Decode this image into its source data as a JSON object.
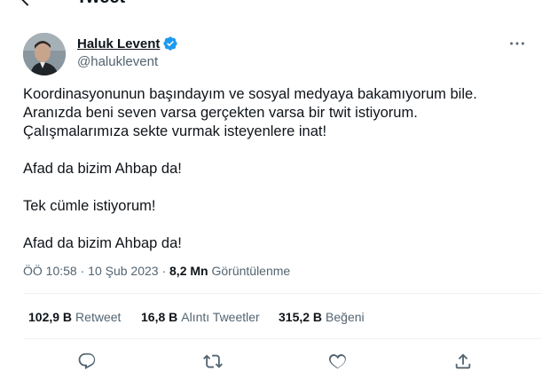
{
  "header": {
    "title": "Tweet"
  },
  "author": {
    "name": "Haluk Levent",
    "handle": "@haluklevent"
  },
  "tweet": {
    "lines": [
      "Koordinasyonunun başındayım ve sosyal medyaya bakamıyorum bile.",
      "Aranızda beni seven varsa gerçekten varsa bir twit istiyorum.",
      "Çalışmalarımıza sekte vurmak isteyenlere inat!",
      "Afad da bizim Ahbap da!",
      "Tek cümle istiyorum!",
      "Afad da bizim Ahbap da!"
    ]
  },
  "meta": {
    "time": "ÖÖ 10:58",
    "sep1": "·",
    "date": "10 Şub 2023",
    "sep2": "·",
    "views_count": "8,2 Mn",
    "views_label": "Görüntülenme"
  },
  "stats": {
    "retweets_count": "102,9 B",
    "retweets_label": "Retweet",
    "quotes_count": "16,8 B",
    "quotes_label": "Alıntı Tweetler",
    "likes_count": "315,2 B",
    "likes_label": "Beğeni"
  },
  "icons": {
    "back": "arrow-left-icon",
    "verified": "verified-badge-icon",
    "more": "more-horizontal-icon",
    "reply": "reply-icon",
    "retweet": "retweet-icon",
    "like": "heart-icon",
    "share": "share-icon"
  },
  "colors": {
    "verified": "#1d9bf0",
    "text": "#0f1419",
    "secondary": "#536471",
    "divider": "#eff3f4"
  }
}
